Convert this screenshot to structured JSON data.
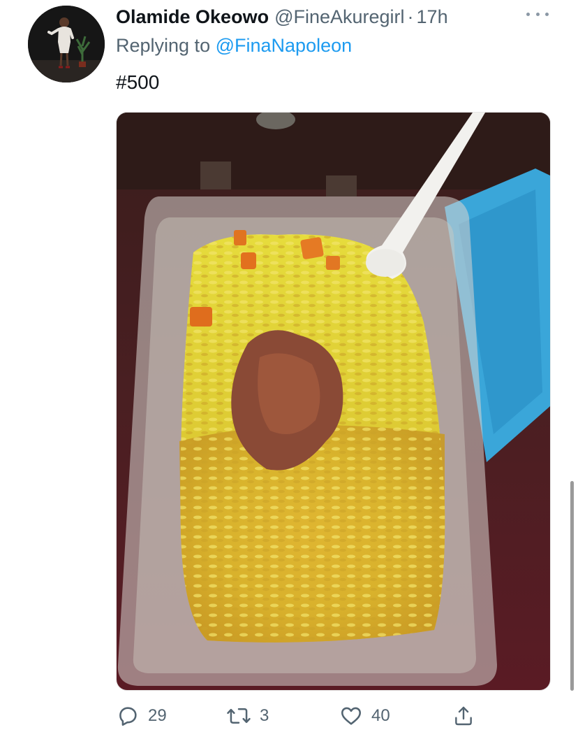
{
  "tweet": {
    "display_name": "Olamide Okeowo",
    "handle": "@FineAkuregirl",
    "separator": "·",
    "time": "17h",
    "replying_prefix": "Replying to",
    "replying_to": "@FinaNapoleon",
    "text": "#500"
  },
  "actions": {
    "reply_count": "29",
    "retweet_count": "3",
    "like_count": "40"
  },
  "icons": {
    "more": "more-horizontal-icon",
    "reply": "reply-icon",
    "retweet": "retweet-icon",
    "like": "heart-icon",
    "share": "share-icon"
  },
  "colors": {
    "text": "#0f1419",
    "secondary": "#536471",
    "link": "#1d9bf0"
  }
}
